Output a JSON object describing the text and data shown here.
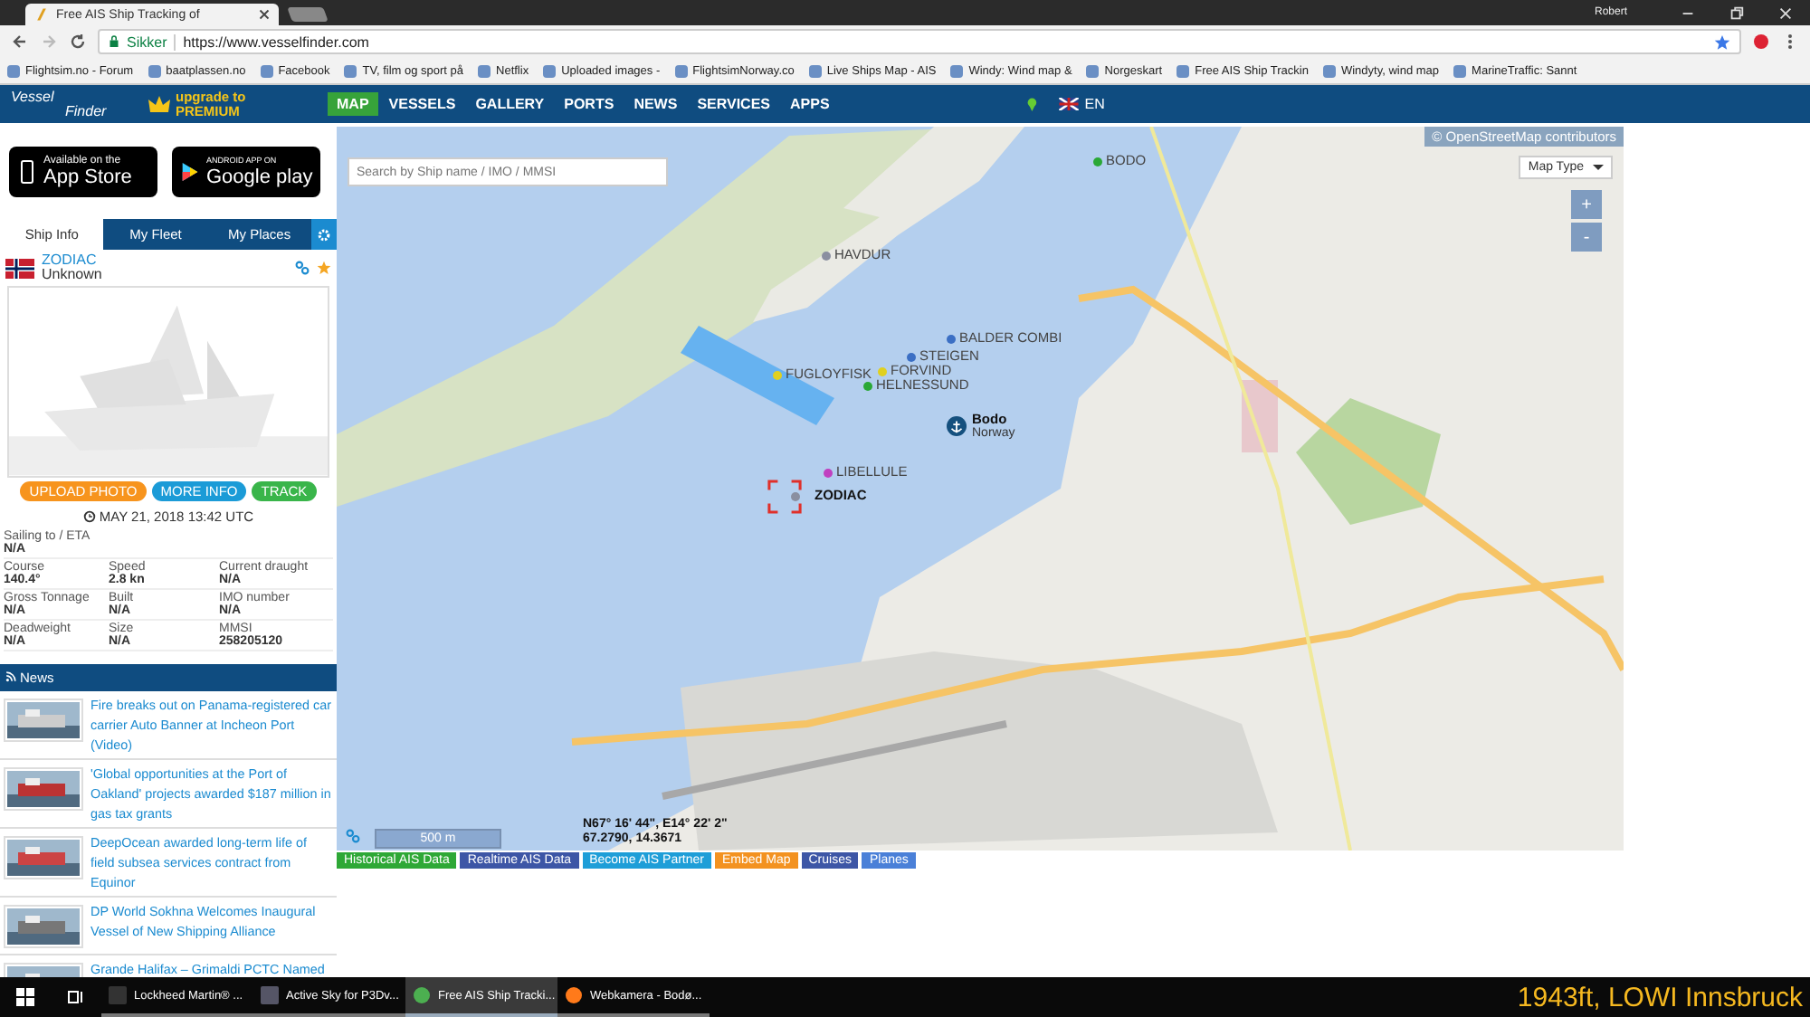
{
  "browser": {
    "tabs": [
      {
        "title": "Free AIS Ship Tracking of",
        "selected": true
      }
    ],
    "user": "Robert",
    "security": "Sikker",
    "url": "https://www.vesselfinder.com",
    "bookmarks": [
      "Flightsim.no - Forum",
      "baatplassen.no",
      "Facebook",
      "TV, film og sport på",
      "Netflix",
      "Uploaded images -",
      "FlightsimNorway.co",
      "Live Ships Map - AIS",
      "Windy: Wind map &",
      "Norgeskart",
      "Free AIS Ship Trackin",
      "Windyty, wind map",
      "MarineTraffic: Sannt"
    ]
  },
  "site_nav": {
    "logo": [
      "Vessel",
      "Finder"
    ],
    "premium": [
      "upgrade to",
      "PREMIUM"
    ],
    "menu": [
      {
        "label": "MAP",
        "selected": true
      },
      {
        "label": "VESSELS",
        "selected": false
      },
      {
        "label": "GALLERY",
        "selected": false
      },
      {
        "label": "PORTS",
        "selected": false
      },
      {
        "label": "NEWS",
        "selected": false
      },
      {
        "label": "SERVICES",
        "selected": false
      },
      {
        "label": "APPS",
        "selected": false
      }
    ],
    "language": "EN"
  },
  "app_badges": [
    {
      "small": "Available on the",
      "big": "App Store"
    },
    {
      "small": "ANDROID APP ON",
      "big": "Google play"
    }
  ],
  "ship_tabs": [
    {
      "label": "Ship Info",
      "selected": true
    },
    {
      "label": "My Fleet",
      "selected": false
    },
    {
      "label": "My Places",
      "selected": false
    }
  ],
  "ship": {
    "name": "ZODIAC",
    "type": "Unknown"
  },
  "actions": [
    {
      "label": "UPLOAD PHOTO",
      "color": "#f7941d"
    },
    {
      "label": "MORE INFO",
      "color": "#1b9bd7"
    },
    {
      "label": "TRACK",
      "color": "#39b54a"
    }
  ],
  "timestamp": "MAY 21, 2018 13:42 UTC",
  "details": [
    [
      {
        "label": "Sailing to / ETA",
        "value": "N/A"
      }
    ],
    [
      {
        "label": "Course",
        "value": "140.4°"
      },
      {
        "label": "Speed",
        "value": "2.8 kn"
      },
      {
        "label": "Current draught",
        "value": "N/A"
      }
    ],
    [
      {
        "label": "Gross Tonnage",
        "value": "N/A"
      },
      {
        "label": "Built",
        "value": "N/A"
      },
      {
        "label": "IMO number",
        "value": "N/A"
      }
    ],
    [
      {
        "label": "Deadweight",
        "value": "N/A"
      },
      {
        "label": "Size",
        "value": "N/A"
      },
      {
        "label": "MMSI",
        "value": "258205120"
      }
    ]
  ],
  "news": {
    "title": "News",
    "items": [
      {
        "text": "Fire breaks out on Panama-registered car carrier Auto Banner at Incheon Port (Video)"
      },
      {
        "text": "'Global opportunities at the Port of Oakland' projects awarded $187 million in gas tax grants"
      },
      {
        "text": "DeepOcean awarded long-term life of field subsea services contract from Equinor"
      },
      {
        "text": "DP World Sokhna Welcomes Inaugural Vessel of New Shipping Alliance"
      },
      {
        "text": "Grande Halifax – Grimaldi PCTC Named"
      }
    ]
  },
  "map": {
    "search": {
      "placeholder": "Search by Ship name / IMO / MMSI"
    },
    "attribution": "© OpenStreetMap contributors",
    "map_type": "Map Type",
    "zoom_in": "+",
    "zoom_out": "-",
    "vessels": [
      {
        "name": "BODO",
        "color": "#2aa836",
        "selected": false
      },
      {
        "name": "HAVDUR",
        "color": "#8a8fa0",
        "selected": false
      },
      {
        "name": "BALDER COMBI",
        "color": "#3b6fc4",
        "selected": false
      },
      {
        "name": "STEIGEN",
        "color": "#3b6fc4",
        "selected": false
      },
      {
        "name": "FORVIND",
        "color": "#e0d020",
        "selected": false
      },
      {
        "name": "FUGLOYFISK",
        "color": "#e0d020",
        "selected": false
      },
      {
        "name": "HELNESSUND",
        "color": "#2aa836",
        "selected": false
      },
      {
        "name": "LIBELLULE",
        "color": "#c040c0",
        "selected": false
      },
      {
        "name": "ZODIAC",
        "color": "#8a8fa0",
        "selected": true
      }
    ],
    "port": {
      "name": "Bodo",
      "country": "Norway"
    },
    "scale": "500 m",
    "coords": [
      "N67° 16' 44\", E14° 22' 2\"",
      "67.2790, 14.3671"
    ]
  },
  "map_links": [
    {
      "label": "Historical AIS Data",
      "color": "#2ea836"
    },
    {
      "label": "Realtime AIS Data",
      "color": "#3d56a6"
    },
    {
      "label": "Become AIS Partner",
      "color": "#1e9ed8"
    },
    {
      "label": "Embed Map",
      "color": "#f39220"
    },
    {
      "label": "Cruises",
      "color": "#3d56a6"
    },
    {
      "label": "Planes",
      "color": "#4a80d8"
    }
  ],
  "taskbar": {
    "apps": [
      {
        "label": "Lockheed Martin® ...",
        "selected": false
      },
      {
        "label": "Active Sky for P3Dv...",
        "selected": false
      },
      {
        "label": "Free AIS Ship Tracki...",
        "selected": true
      },
      {
        "label": "Webkamera - Bodø...",
        "selected": false
      }
    ],
    "overlay": "1943ft, LOWI Innsbruck"
  }
}
